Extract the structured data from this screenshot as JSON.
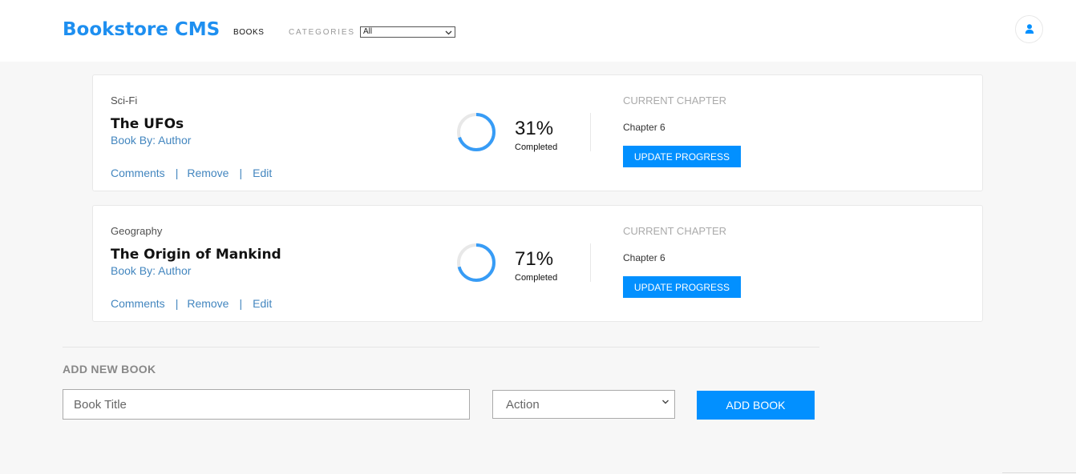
{
  "header": {
    "logo": "Bookstore CMS",
    "nav_books": "BOOKS",
    "nav_categories": "CATEGORIES",
    "category_filter": "All",
    "user_icon": "user-icon"
  },
  "books": [
    {
      "genre": "Sci-Fi",
      "title": "The UFOs",
      "author": "Book By: Author",
      "actions": {
        "comments": "Comments",
        "remove": "Remove",
        "edit": "Edit",
        "separator": "|"
      },
      "progress": 0.31,
      "percent_label": "31%",
      "completed_label": "Completed",
      "current_chapter_label": "CURRENT CHAPTER",
      "chapter": "Chapter 6",
      "update_label": "UPDATE PROGRESS"
    },
    {
      "genre": "Geography",
      "title": "The Origin of Mankind",
      "author": "Book By: Author",
      "actions": {
        "comments": "Comments",
        "remove": "Remove",
        "edit": "Edit",
        "separator": "|"
      },
      "progress": 0.71,
      "percent_label": "71%",
      "completed_label": "Completed",
      "current_chapter_label": "CURRENT CHAPTER",
      "chapter": "Chapter 6",
      "update_label": "UPDATE PROGRESS"
    }
  ],
  "add_form": {
    "heading": "ADD NEW BOOK",
    "title_placeholder": "Book Title",
    "category_value": "Action",
    "submit_label": "ADD BOOK"
  },
  "colors": {
    "brand": "#1e8ff0",
    "button": "#0290ff",
    "link": "#4386bf",
    "ring_progress": "#379cf6",
    "ring_track": "#e8e8e8"
  }
}
